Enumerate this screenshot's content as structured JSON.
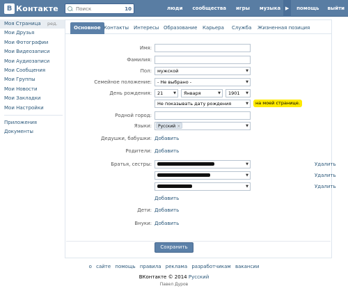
{
  "header": {
    "logo_letter": "В",
    "logo_text": "Контакте",
    "search_placeholder": "Поиск",
    "search_count": "10",
    "nav": [
      "люди",
      "сообщества",
      "игры",
      "музыка",
      "помощь",
      "выйти"
    ],
    "nav_arrow": "▶"
  },
  "sidebar": {
    "edit": "ред.",
    "items": [
      "Моя Страница",
      "Мои Друзья",
      "Мои Фотографии",
      "Мои Видеозаписи",
      "Мои Аудиозаписи",
      "Мои Сообщения",
      "Мои Группы",
      "Мои Новости",
      "Мои Закладки",
      "Мои Настройки"
    ],
    "extra": [
      "Приложения",
      "Документы"
    ]
  },
  "tabs": [
    "Основное",
    "Контакты",
    "Интересы",
    "Образование",
    "Карьера",
    "Служба",
    "Жизненная позиция"
  ],
  "form": {
    "first_name": {
      "label": "Имя:",
      "value": ""
    },
    "last_name": {
      "label": "Фамилия:",
      "value": ""
    },
    "gender": {
      "label": "Пол:",
      "value": "мужской"
    },
    "marital": {
      "label": "Семейное положение:",
      "value": "- Не выбрано -"
    },
    "birthday": {
      "label": "День рождения:",
      "day": "21",
      "month": "Января",
      "year": "1901",
      "visibility": "Не показывать дату рождения",
      "hint": "на моей странице."
    },
    "hometown": {
      "label": "Родной город:",
      "value": ""
    },
    "languages": {
      "label": "Языки:",
      "tag": "Русский",
      "tag_remove": "×"
    },
    "grandparents": {
      "label": "Дедушки, бабушки:",
      "add": "Добавить"
    },
    "parents": {
      "label": "Родители:",
      "add": "Добавить"
    },
    "siblings": {
      "label": "Братья, сестры:",
      "remove": "Удалить",
      "add": "Добавить"
    },
    "children": {
      "label": "Дети:",
      "add": "Добавить"
    },
    "grandchildren": {
      "label": "Внуки:",
      "add": "Добавить"
    },
    "save": "Сохранить"
  },
  "footer": {
    "links": [
      "о сайте",
      "помощь",
      "правила",
      "реклама",
      "разработчикам",
      "вакансии"
    ],
    "copyright": "ВКонтакте © 2014",
    "language": "Русский",
    "developer": "Павел Дуров"
  }
}
